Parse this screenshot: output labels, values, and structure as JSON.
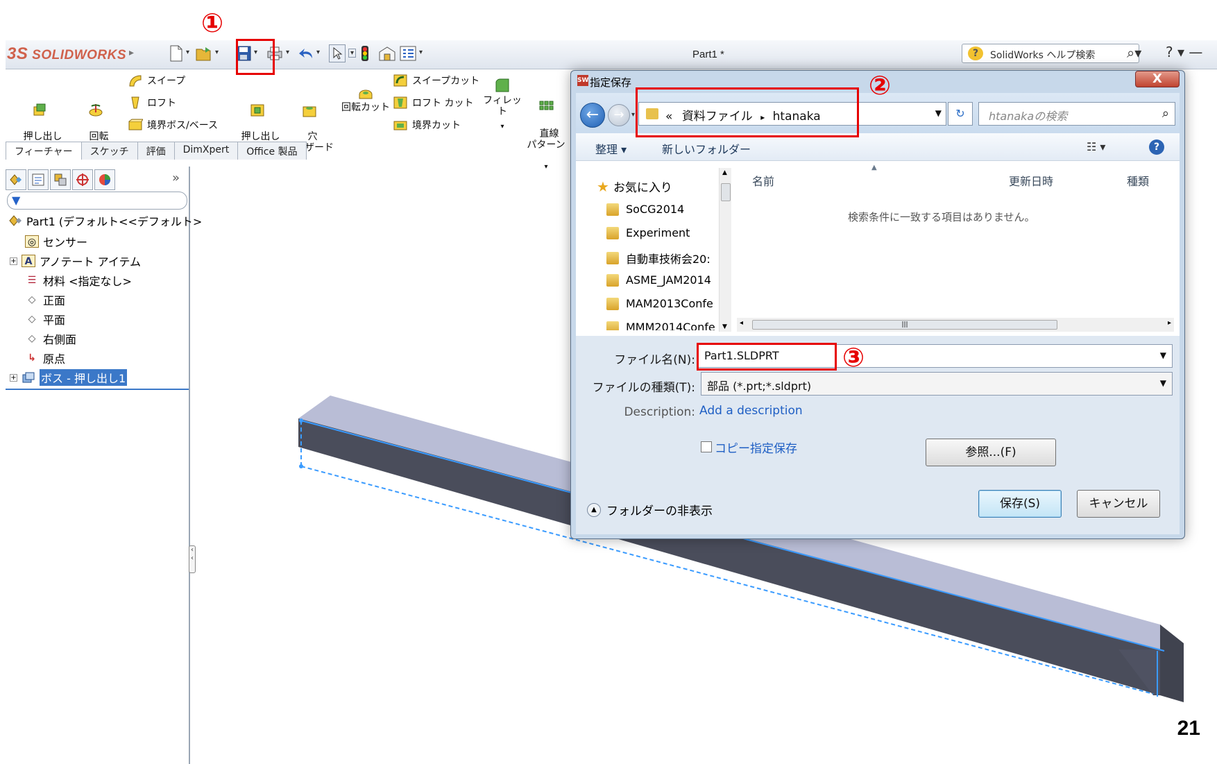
{
  "annotations": {
    "step1": "①",
    "step2": "②",
    "step3": "③",
    "page_number": "21"
  },
  "app": {
    "logo": "SOLIDWORKS",
    "logo_mark": "3S",
    "document_title": "Part1 *",
    "help_search_placeholder": "SolidWorks ヘルプ検索"
  },
  "command_manager": {
    "extrude_boss": "押し出し\nボス/ベース",
    "revolve_boss": "回転\nボス/ベース",
    "sweep": "スイープ",
    "loft": "ロフト",
    "boundary_boss": "境界ボス/ベース",
    "extrude_cut": "押し出し\nカット",
    "hole_wizard": "穴\nウィザード",
    "revolve_cut": "回転カット",
    "sweep_cut": "スイープカット",
    "loft_cut": "ロフト カット",
    "boundary_cut": "境界カット",
    "fillet": "フィレット",
    "linear_pattern": "直線\nパターン"
  },
  "tabs": [
    "フィーチャー",
    "スケッチ",
    "評価",
    "DimXpert",
    "Office 製品"
  ],
  "feature_tree": {
    "root": "Part1 (デフォルト<<デフォルト>",
    "items": [
      "センサー",
      "アノテート アイテム",
      "材料 <指定なし>",
      "正面",
      "平面",
      "右側面",
      "原点",
      "ボス - 押し出し1"
    ]
  },
  "dialog": {
    "title": "指定保存",
    "close": "X",
    "address": {
      "prefix": "«",
      "segment1": "資料ファイル",
      "sep": "▸",
      "segment2": "htanaka"
    },
    "search_placeholder": "htanakaの検索",
    "organize": "整理 ▾",
    "new_folder": "新しいフォルダー",
    "favorites": "お気に入り",
    "folders": [
      "SoCG2014",
      "Experiment",
      "自動車技術会20:",
      "ASME_JAM2014",
      "MAM2013Confe",
      "MMM2014Confe"
    ],
    "columns": {
      "name": "名前",
      "date": "更新日時",
      "type": "種類"
    },
    "empty_message": "検索条件に一致する項目はありません。",
    "file_name_label": "ファイル名(N):",
    "file_name_value": "Part1.SLDPRT",
    "file_type_label": "ファイルの種類(T):",
    "file_type_value": "部品 (*.prt;*.sldprt)",
    "description_label": "Description:",
    "description_value": "Add a description",
    "copy_save": "コピー指定保存",
    "browse": "参照...(F)",
    "save": "保存(S)",
    "cancel": "キャンセル",
    "hide_folders": "フォルダーの非表示"
  },
  "colors": {
    "annotation_red": "#e60000",
    "selection_blue": "#3b78c8",
    "part_dark": "#4a4e5c",
    "part_top": "#b7bdd6",
    "edge_blue": "#3a9bff"
  }
}
